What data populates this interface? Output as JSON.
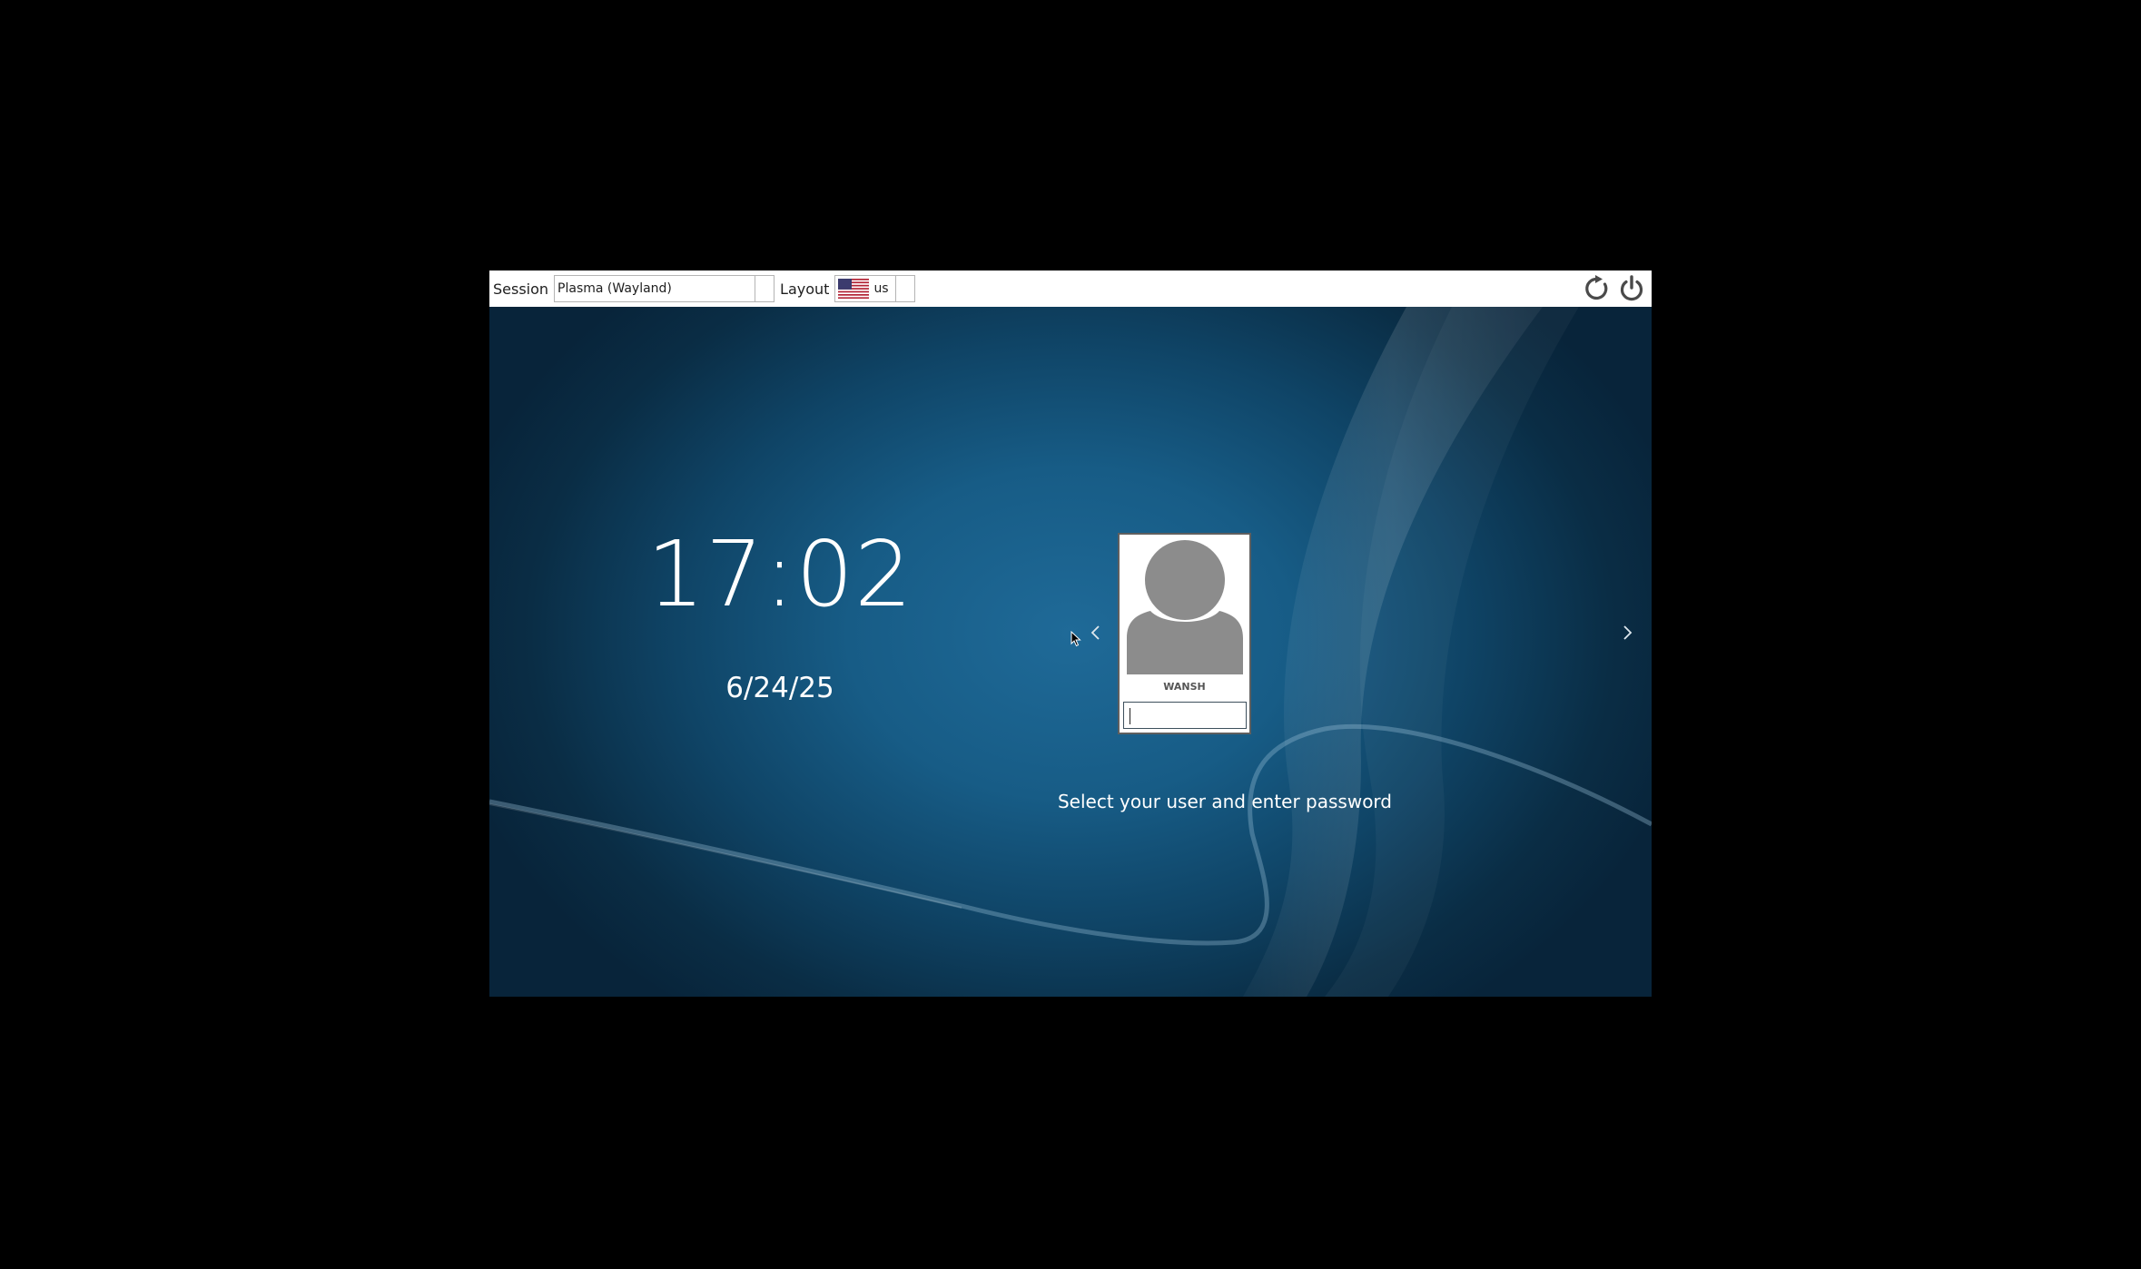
{
  "topbar": {
    "session_label": "Session",
    "session_value": "Plasma (Wayland)",
    "layout_label": "Layout",
    "layout_value": "us",
    "layout_flag_icon": "us-flag-icon",
    "reboot_icon": "reboot-icon",
    "shutdown_icon": "power-icon"
  },
  "greeter": {
    "time": "17:02",
    "date": "6/24/25",
    "user": {
      "name": "WANSH",
      "avatar_icon": "user-avatar-icon"
    },
    "password": {
      "value": "",
      "placeholder": ""
    },
    "hint": "Select your user and enter password",
    "prev_icon": "chevron-left-icon",
    "next_icon": "chevron-right-icon"
  },
  "colors": {
    "topbar_bg": "#ffffff",
    "background_center": "#1f6a98",
    "background_edge": "#08243a",
    "text": "#ffffff"
  }
}
